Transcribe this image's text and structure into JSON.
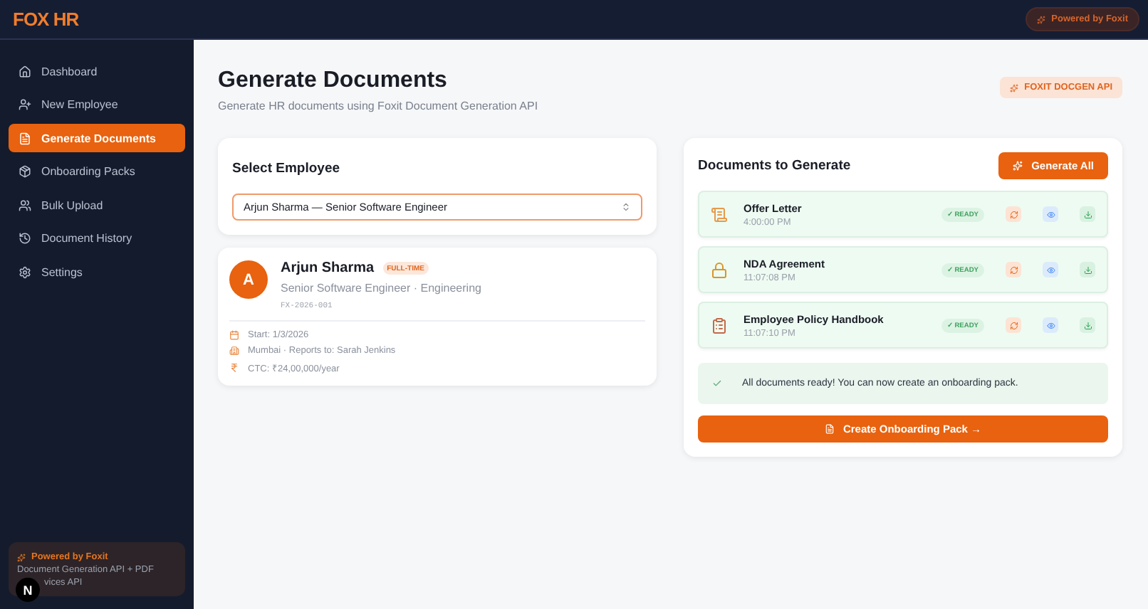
{
  "brand": "FOX HR",
  "header_badge": "Powered by Foxit",
  "sidebar": {
    "items": [
      {
        "label": "Dashboard",
        "selected": false
      },
      {
        "label": "New Employee",
        "selected": false
      },
      {
        "label": "Generate Documents",
        "selected": true
      },
      {
        "label": "Onboarding Packs",
        "selected": false
      },
      {
        "label": "Bulk Upload",
        "selected": false
      },
      {
        "label": "Document History",
        "selected": false
      },
      {
        "label": "Settings",
        "selected": false
      }
    ],
    "footer": {
      "title": "Powered by Foxit",
      "lines": [
        "Document Generation API + PDF",
        "vices API"
      ],
      "dev_badge": "N"
    }
  },
  "page": {
    "title": "Generate Documents",
    "subtitle": "Generate HR documents using Foxit Document Generation API",
    "api_badge": "FOXIT DOCGEN API"
  },
  "select_employee": {
    "title": "Select Employee",
    "value": "Arjun Sharma — Senior Software Engineer"
  },
  "employee": {
    "initial": "A",
    "name": "Arjun Sharma",
    "type": "FULL-TIME",
    "role": "Senior Software Engineer · Engineering",
    "id": "FX-2026-001",
    "details": [
      "Start: 1/3/2026",
      "Mumbai · Reports to: Sarah Jenkins",
      "CTC: ₹24,00,000/year"
    ]
  },
  "documents": {
    "title": "Documents to Generate",
    "generate_all": "Generate All",
    "items": [
      {
        "name": "Offer Letter",
        "time": "4:00:00 PM",
        "status": "✓ READY"
      },
      {
        "name": "NDA Agreement",
        "time": "11:07:08 PM",
        "status": "✓ READY"
      },
      {
        "name": "Employee Policy Handbook",
        "time": "11:07:10 PM",
        "status": "✓ READY"
      }
    ],
    "notice": "All documents ready! You can now create an onboarding pack.",
    "create_pack": "Create Onboarding Pack →"
  }
}
